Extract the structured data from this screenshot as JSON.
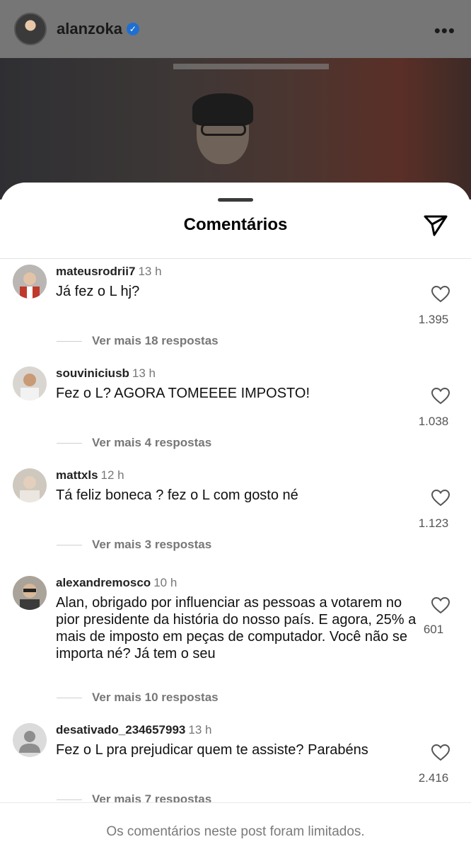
{
  "post": {
    "username": "alanzoka",
    "verified_mark": "✓",
    "more_label": "•••"
  },
  "sheet": {
    "title": "Comentários",
    "share_icon": "send-icon"
  },
  "comments": [
    {
      "username": "mateusrodrii7",
      "time": "13 h",
      "text": "Já fez o L hj?",
      "likes": "1.395",
      "replies": "Ver mais 18 respostas"
    },
    {
      "username": "souviniciusb",
      "time": "13 h",
      "text": "Fez o L? AGORA TOMEEEE IMPOSTO!",
      "likes": "1.038",
      "replies": "Ver mais 4 respostas"
    },
    {
      "username": "mattxls",
      "time": "12 h",
      "text": "Tá feliz boneca ? fez o L com gosto né",
      "likes": "1.123",
      "replies": "Ver mais 3 respostas"
    },
    {
      "username": "alexandremosco",
      "time": "10 h",
      "text": "Alan, obrigado por influenciar as pessoas a votarem no pior presidente da história do nosso país. E agora, 25% a mais de imposto em peças de computador. Você não se importa né? Já tem o seu",
      "likes": "601",
      "replies": "Ver mais 10 respostas"
    },
    {
      "username": "desativado_234657993",
      "time": "13 h",
      "text": "Fez o L pra prejudicar quem te assiste? Parabéns",
      "likes": "2.416",
      "replies": "Ver mais 7 respostas"
    }
  ],
  "footer": {
    "text": "Os comentários neste post foram limitados."
  }
}
